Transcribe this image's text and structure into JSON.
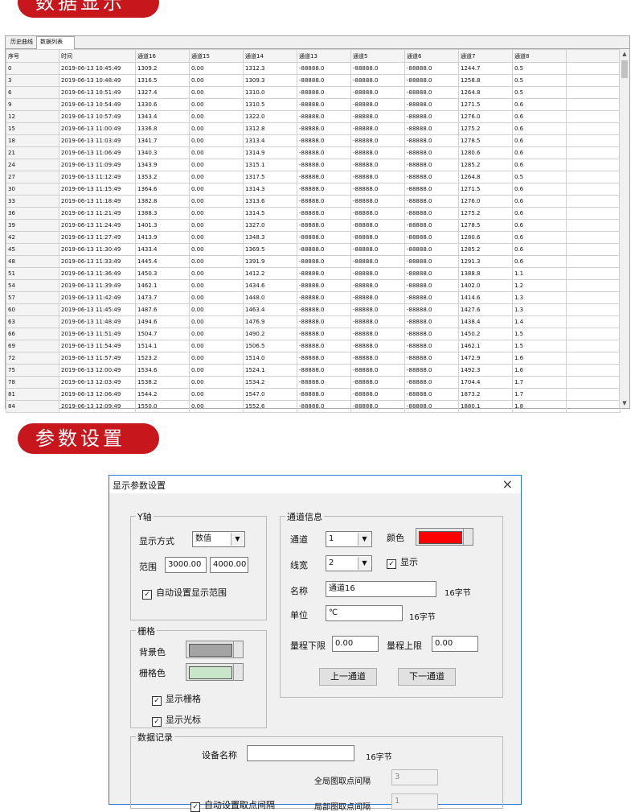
{
  "banners": {
    "data_display": "数据显示",
    "param_settings": "参数设置"
  },
  "tabs": [
    "历史曲线",
    "数据列表"
  ],
  "table": {
    "headers": [
      "序号",
      "时间",
      "通道16",
      "通道15",
      "通道14",
      "通道13",
      "通道5",
      "通道6",
      "通道7",
      "通道8",
      ""
    ],
    "rows": [
      [
        "0",
        "2019-06-13 10:45:49",
        "1309.2",
        "0.00",
        "1312.3",
        "-88888.0",
        "-88888.0",
        "-88888.0",
        "1244.7",
        "0.5",
        ""
      ],
      [
        "3",
        "2019-06-13 10:48:49",
        "1316.5",
        "0.00",
        "1309.3",
        "-88888.0",
        "-88888.0",
        "-88888.0",
        "1258.8",
        "0.5",
        ""
      ],
      [
        "6",
        "2019-06-13 10:51:49",
        "1327.4",
        "0.00",
        "1310.0",
        "-88888.0",
        "-88888.0",
        "-88888.0",
        "1264.8",
        "0.5",
        ""
      ],
      [
        "9",
        "2019-06-13 10:54:49",
        "1330.6",
        "0.00",
        "1310.5",
        "-88888.0",
        "-88888.0",
        "-88888.0",
        "1271.5",
        "0.6",
        ""
      ],
      [
        "12",
        "2019-06-13 10:57:49",
        "1343.4",
        "0.00",
        "1322.0",
        "-88888.0",
        "-88888.0",
        "-88888.0",
        "1276.0",
        "0.6",
        ""
      ],
      [
        "15",
        "2019-06-13 11:00:49",
        "1336.8",
        "0.00",
        "1312.8",
        "-88888.0",
        "-88888.0",
        "-88888.0",
        "1275.2",
        "0.6",
        ""
      ],
      [
        "18",
        "2019-06-13 11:03:49",
        "1341.7",
        "0.00",
        "1313.4",
        "-88888.0",
        "-88888.0",
        "-88888.0",
        "1278.5",
        "0.6",
        ""
      ],
      [
        "21",
        "2019-06-13 11:06:49",
        "1340.3",
        "0.00",
        "1314.9",
        "-88888.0",
        "-88888.0",
        "-88888.0",
        "1280.6",
        "0.6",
        ""
      ],
      [
        "24",
        "2019-06-13 11:09:49",
        "1343.9",
        "0.00",
        "1315.1",
        "-88888.0",
        "-88888.0",
        "-88888.0",
        "1285.2",
        "0.6",
        ""
      ],
      [
        "27",
        "2019-06-13 11:12:49",
        "1353.2",
        "0.00",
        "1317.5",
        "-88888.0",
        "-88888.0",
        "-88888.0",
        "1264.8",
        "0.5",
        ""
      ],
      [
        "30",
        "2019-06-13 11:15:49",
        "1364.6",
        "0.00",
        "1314.3",
        "-88888.0",
        "-88888.0",
        "-88888.0",
        "1271.5",
        "0.6",
        ""
      ],
      [
        "33",
        "2019-06-13 11:18:49",
        "1382.8",
        "0.00",
        "1313.6",
        "-88888.0",
        "-88888.0",
        "-88888.0",
        "1276.0",
        "0.6",
        ""
      ],
      [
        "36",
        "2019-06-13 11:21:49",
        "1388.3",
        "0.00",
        "1314.5",
        "-88888.0",
        "-88888.0",
        "-88888.0",
        "1275.2",
        "0.6",
        ""
      ],
      [
        "39",
        "2019-06-13 11:24:49",
        "1401.3",
        "0.00",
        "1327.0",
        "-88888.0",
        "-88888.0",
        "-88888.0",
        "1278.5",
        "0.6",
        ""
      ],
      [
        "42",
        "2019-06-13 11:27:49",
        "1413.9",
        "0.00",
        "1348.3",
        "-88888.0",
        "-88888.0",
        "-88888.0",
        "1280.6",
        "0.6",
        ""
      ],
      [
        "45",
        "2019-06-13 11:30:49",
        "1433.4",
        "0.00",
        "1369.5",
        "-88888.0",
        "-88888.0",
        "-88888.0",
        "1285.2",
        "0.6",
        ""
      ],
      [
        "48",
        "2019-06-13 11:33:49",
        "1445.4",
        "0.00",
        "1391.9",
        "-88888.0",
        "-88888.0",
        "-88888.0",
        "1291.3",
        "0.6",
        ""
      ],
      [
        "51",
        "2019-06-13 11:36:49",
        "1450.3",
        "0.00",
        "1412.2",
        "-88888.0",
        "-88888.0",
        "-88888.0",
        "1388.8",
        "1.1",
        ""
      ],
      [
        "54",
        "2019-06-13 11:39:49",
        "1462.1",
        "0.00",
        "1434.6",
        "-88888.0",
        "-88888.0",
        "-88888.0",
        "1402.0",
        "1.2",
        ""
      ],
      [
        "57",
        "2019-06-13 11:42:49",
        "1473.7",
        "0.00",
        "1448.0",
        "-88888.0",
        "-88888.0",
        "-88888.0",
        "1414.6",
        "1.3",
        ""
      ],
      [
        "60",
        "2019-06-13 11:45:49",
        "1487.6",
        "0.00",
        "1463.4",
        "-88888.0",
        "-88888.0",
        "-88888.0",
        "1427.6",
        "1.3",
        ""
      ],
      [
        "63",
        "2019-06-13 11:48:49",
        "1494.6",
        "0.00",
        "1476.9",
        "-88888.0",
        "-88888.0",
        "-88888.0",
        "1438.4",
        "1.4",
        ""
      ],
      [
        "66",
        "2019-06-13 11:51:49",
        "1504.7",
        "0.00",
        "1490.2",
        "-88888.0",
        "-88888.0",
        "-88888.0",
        "1450.2",
        "1.5",
        ""
      ],
      [
        "69",
        "2019-06-13 11:54:49",
        "1514.1",
        "0.00",
        "1506.5",
        "-88888.0",
        "-88888.0",
        "-88888.0",
        "1462.1",
        "1.5",
        ""
      ],
      [
        "72",
        "2019-06-13 11:57:49",
        "1523.2",
        "0.00",
        "1514.0",
        "-88888.0",
        "-88888.0",
        "-88888.0",
        "1472.9",
        "1.6",
        ""
      ],
      [
        "75",
        "2019-06-13 12:00:49",
        "1534.6",
        "0.00",
        "1524.1",
        "-88888.0",
        "-88888.0",
        "-88888.0",
        "1492.3",
        "1.6",
        ""
      ],
      [
        "78",
        "2019-06-13 12:03:49",
        "1538.2",
        "0.00",
        "1534.2",
        "-88888.0",
        "-88888.0",
        "-88888.0",
        "1704.4",
        "1.7",
        ""
      ],
      [
        "81",
        "2019-06-13 12:06:49",
        "1544.2",
        "0.00",
        "1547.0",
        "-88888.0",
        "-88888.0",
        "-88888.0",
        "1873.2",
        "1.7",
        ""
      ],
      [
        "84",
        "2019-06-13 12:09:49",
        "1550.0",
        "0.00",
        "1552.6",
        "-88888.0",
        "-88888.0",
        "-88888.0",
        "1880.1",
        "1.8",
        ""
      ]
    ]
  },
  "dialog": {
    "title": "显示参数设置",
    "close": "×",
    "y_axis": {
      "title": "Y轴",
      "mode_label": "显示方式",
      "mode_value": "数值",
      "range_label": "范围",
      "range_min": "3000.00",
      "range_max": "4000.00",
      "auto_range_label": "自动设置显示范围"
    },
    "grid": {
      "title": "栅格",
      "bg_color_label": "背景色",
      "grid_color_label": "栅格色",
      "bg_color": "#a3a3a3",
      "grid_color": "#c8e6c9",
      "show_grid_label": "显示栅格",
      "show_cursor_label": "显示光标"
    },
    "channel": {
      "title": "通道信息",
      "channel_label": "通道",
      "channel_value": "1",
      "color_label": "颜色",
      "color": "#ff0000",
      "line_width_label": "线宽",
      "line_width_value": "2",
      "show_label": "显示",
      "name_label": "名称",
      "name_value": "通道16",
      "name_hint": "16字节",
      "unit_label": "单位",
      "unit_value": "℃",
      "unit_hint": "16字节",
      "range_low_label": "量程下限",
      "range_low_value": "0.00",
      "range_high_label": "量程上限",
      "range_high_value": "0.00",
      "prev_button": "上一通道",
      "next_button": "下一通道"
    },
    "record": {
      "title": "数据记录",
      "device_name_label": "设备名称",
      "device_name_value": "",
      "device_name_hint": "16字节",
      "global_interval_label": "全局图取点间隔",
      "global_interval_value": "3",
      "auto_interval_label": "自动设置取点间隔",
      "local_interval_label": "局部图取点间隔",
      "local_interval_value": "1"
    },
    "checkmark": "✓"
  }
}
